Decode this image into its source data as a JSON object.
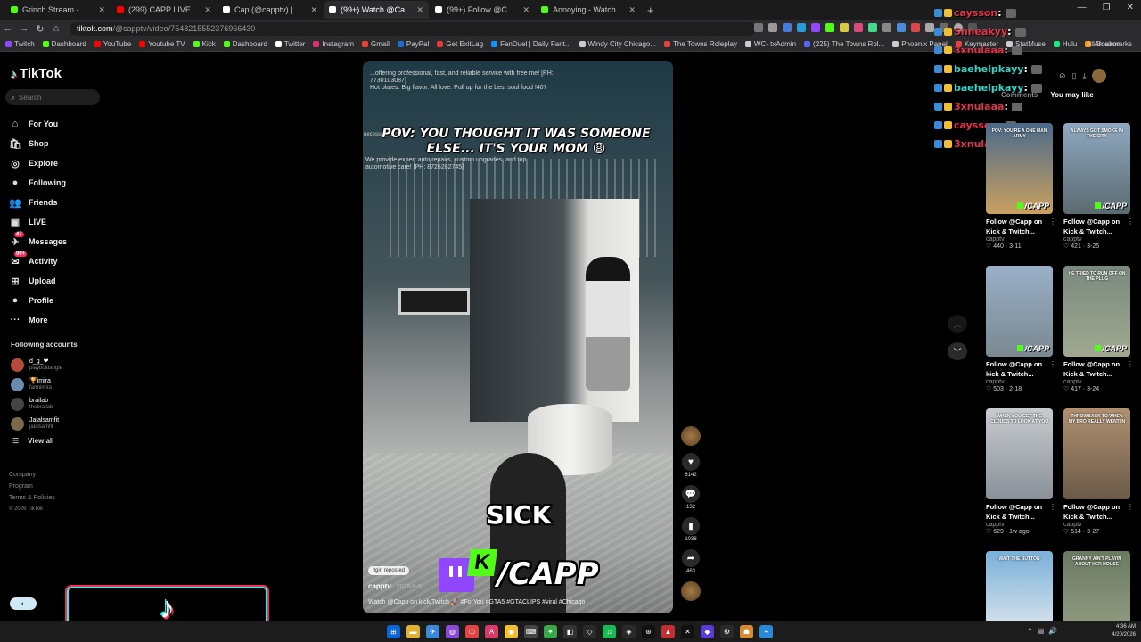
{
  "browser": {
    "tabs": [
      {
        "label": "Grinch Stream - Watch Live on",
        "color": "#53fc18",
        "active": false
      },
      {
        "label": "(299) CAPP LIVE - YouTube",
        "color": "#ff0000",
        "active": false
      },
      {
        "label": "Cap (@capptv) | TikTok",
        "color": "#ffffff",
        "active": false
      },
      {
        "label": "(99+) Watch @Capp on kick/Tw",
        "color": "#ffffff",
        "active": true
      },
      {
        "label": "(99+) Follow @Capp on kick/Tw",
        "color": "#ffffff",
        "active": false
      },
      {
        "label": "Annoying - Watch clips on Kick",
        "color": "#53fc18",
        "active": false
      }
    ],
    "url_host": "tiktok.com",
    "url_path": "/@capptv/video/7548215552376966430",
    "bookmarks": [
      {
        "label": "Twitch",
        "color": "#9146ff"
      },
      {
        "label": "Dashboard",
        "color": "#53fc18"
      },
      {
        "label": "YouTube",
        "color": "#ff0000"
      },
      {
        "label": "Youtube TV",
        "color": "#ff0000"
      },
      {
        "label": "Kick",
        "color": "#53fc18"
      },
      {
        "label": "Dashboard",
        "color": "#53fc18"
      },
      {
        "label": "Twitter",
        "color": "#ffffff"
      },
      {
        "label": "Instagram",
        "color": "#e1306c"
      },
      {
        "label": "Gmail",
        "color": "#ea4335"
      },
      {
        "label": "PayPal",
        "color": "#1f6fd0"
      },
      {
        "label": "Get ExitLag",
        "color": "#e23b3b"
      },
      {
        "label": "FanDuel | Daily Fant...",
        "color": "#1493ff"
      },
      {
        "label": "Windy City Chicago...",
        "color": "#cccccc"
      },
      {
        "label": "The Towns Roleplay",
        "color": "#e04444"
      },
      {
        "label": "WC- txAdmin",
        "color": "#cccccc"
      },
      {
        "label": "(225) The Towns Rol...",
        "color": "#5865f2"
      },
      {
        "label": "Phoenix Panel",
        "color": "#cccccc"
      },
      {
        "label": "Keymaster",
        "color": "#e04444"
      },
      {
        "label": "StatMuse",
        "color": "#cccccc"
      },
      {
        "label": "Hulu",
        "color": "#1ce783"
      },
      {
        "label": "Amazon",
        "color": "#ff9900"
      }
    ],
    "all_bookmarks": "All Bookmarks"
  },
  "sidebar": {
    "brand": "TikTok",
    "search_placeholder": "Search",
    "nav": [
      {
        "label": "For You",
        "icon": "home-icon",
        "glyph": "⌂"
      },
      {
        "label": "Shop",
        "icon": "shop-icon",
        "glyph": "🛍"
      },
      {
        "label": "Explore",
        "icon": "compass-icon",
        "glyph": "◎"
      },
      {
        "label": "Following",
        "icon": "following-icon",
        "glyph": "●"
      },
      {
        "label": "Friends",
        "icon": "friends-icon",
        "glyph": "👥"
      },
      {
        "label": "LIVE",
        "icon": "live-icon",
        "glyph": "▣"
      },
      {
        "label": "Messages",
        "icon": "messages-icon",
        "glyph": "✈",
        "badge": "47"
      },
      {
        "label": "Activity",
        "icon": "activity-icon",
        "glyph": "✉",
        "badge": "99+"
      },
      {
        "label": "Upload",
        "icon": "upload-icon",
        "glyph": "⊞"
      },
      {
        "label": "Profile",
        "icon": "profile-icon",
        "glyph": "●"
      },
      {
        "label": "More",
        "icon": "more-icon",
        "glyph": "···"
      }
    ],
    "following_title": "Following accounts",
    "accounts": [
      {
        "name": "d_g_❤",
        "handle": "playboidangle",
        "color": "#b34a3a"
      },
      {
        "name": "🏆imira",
        "handle": "farmimira",
        "color": "#6a8ab0"
      },
      {
        "name": "brailab",
        "handle": "thebrailab",
        "color": "#444444"
      },
      {
        "name": "Jalalsamfit",
        "handle": "jalalsamfit",
        "color": "#7a6a4a"
      }
    ],
    "view_all": "View all",
    "footer": [
      "Company",
      "Program",
      "Terms & Policies"
    ],
    "copyright": "© 2026 TikTok"
  },
  "video": {
    "promo_top": "...offering professional, fast, and reliable service with free me! [PH: 7730103087]",
    "promo_food": "Hot plates. Big flavor. All love. Pull up for the best soul food !407",
    "promo_necessary": "necessary presc",
    "promo_auto": "We provide expert auto repairs, custom upgrades, and top automotive care! [PH: 8726282745]",
    "caption": "POV: YOU THOUGHT IT WAS SOMEONE ELSE... IT'S YOUR MOM 😩",
    "overlay_word": "SICK",
    "brand_handle": "/CAPP",
    "repost_label": "itgirl reposted",
    "author": "capptv",
    "date": "2025-9-9",
    "description": "Watch @Capp on kick/Twitch 🚀 #ForYou #GTA5 #GTACLIPS #viral #Chicago"
  },
  "actions": {
    "likes": "6142",
    "comments": "132",
    "saves": "1038",
    "shares": "463"
  },
  "chat": [
    {
      "name": "caysson",
      "color": "#e0344a"
    },
    {
      "name": "Shneakyy",
      "color": "#e0344a"
    },
    {
      "name": "3xnulaaa",
      "color": "#e0344a"
    },
    {
      "name": "baehelpkayy",
      "color": "#2fd6c8"
    },
    {
      "name": "baehelpkayy",
      "color": "#2fd6c8"
    },
    {
      "name": "3xnulaaa",
      "color": "#e0344a"
    },
    {
      "name": "caysson",
      "color": "#e0344a"
    },
    {
      "name": "3xnulaaa",
      "color": "#e0344a"
    }
  ],
  "right_panel": {
    "tab_comments": "Comments",
    "tab_you_may_like": "You may like",
    "cards": [
      {
        "thumb_text": "POV: YOU'RE A ONE MAN ARMY",
        "title": "Follow @Capp on Kick & Twitch...",
        "user": "capptv",
        "meta": "♡ 440 · 3-11",
        "color_a": "#4b6a8a",
        "color_b": "#c9a060"
      },
      {
        "thumb_text": "ALWAYS GOT SMOKE IN THE CITY",
        "title": "Follow @Capp on Kick & Twitch...",
        "user": "capptv",
        "meta": "♡ 421 · 3-25",
        "color_a": "#8fa8c0",
        "color_b": "#5a6a70"
      },
      {
        "thumb_text": "",
        "title": "Follow @Capp on kick & Twitch...",
        "user": "capptv",
        "meta": "♡ 503 · 2-18",
        "color_a": "#9ab0c8",
        "color_b": "#7a8890"
      },
      {
        "thumb_text": "HE TRIED TO RUN OFF ON THE PLUG",
        "title": "Follow @Capp on Kick & Twitch...",
        "user": "capptv",
        "meta": "♡ 417 · 3-24",
        "color_a": "#7a8a80",
        "color_b": "#a0a890"
      },
      {
        "thumb_text": "WHEN YOU GET THE CLOUDS TO LOOK AT YOU",
        "title": "Follow @Capp on Kick & Twitch...",
        "user": "capptv",
        "meta": "♡ 629 · 1w ago",
        "color_a": "#c8ccd0",
        "color_b": "#8a9098"
      },
      {
        "thumb_text": "THROWBACK TO WHEN MY BRO REALLY WENT IN",
        "title": "Follow @Capp on Kick & Twitch...",
        "user": "capptv",
        "meta": "♡ 514 · 3-27",
        "color_a": "#b09070",
        "color_b": "#6a5a48"
      },
      {
        "thumb_text": "WAIT THE BUTTON",
        "title": "",
        "user": "",
        "meta": "",
        "color_a": "#7ab0d8",
        "color_b": "#e8ecf0"
      },
      {
        "thumb_text": "GRANNY AIN'T PLAYIN ABOUT HER HOUSE",
        "title": "",
        "user": "",
        "meta": "",
        "color_a": "#6a7a60",
        "color_b": "#98a088"
      }
    ]
  },
  "taskbar": {
    "time": "4:36 AM",
    "date": "4/20/2026"
  }
}
